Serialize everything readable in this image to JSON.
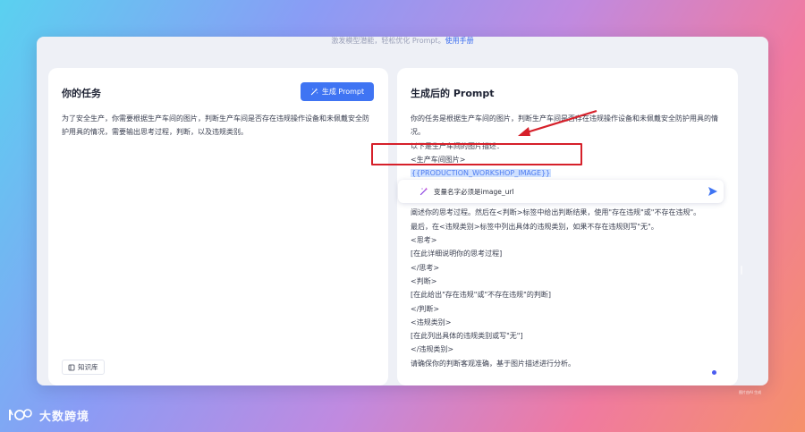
{
  "header": {
    "hint": "激发模型潜能，轻松优化 Prompt。",
    "manual_link": "使用手册"
  },
  "left_panel": {
    "title": "你的任务",
    "generate_button": "生成 Prompt",
    "task_text": "为了安全生产，你需要根据生产车间的图片，判断生产车间是否存在违规操作设备和未佩戴安全防护用具的情况，需要输出思考过程，判断，以及违规类别。",
    "knowledge_base_button": "知识库"
  },
  "right_panel": {
    "title": "生成后的 Prompt",
    "lines_top": [
      "你的任务是根据生产车间的图片，判断生产车间是否存在违规操作设备和未佩戴安全防护用具的情况。",
      "以下是生产车间的图片描述：",
      "<生产车间图片>"
    ],
    "variable": "{{PRODUCTION_WORKSHOP_IMAGE}}",
    "lines_bottom": [
      "阐述你的思考过程。然后在<判断>标签中给出判断结果，使用\"存在违规\"或\"不存在违规\"。",
      "最后，在<违规类别>标签中列出具体的违规类别，如果不存在违规则写\"无\"。",
      "<思考>",
      "[在此详细说明你的思考过程]",
      "</思考>",
      "<判断>",
      "[在此给出\"存在违规\"或\"不存在违规\"的判断]",
      "</判断>",
      "<违规类别>",
      "[在此列出具体的违规类别或写\"无\"]",
      "</违规类别>",
      "请确保你的判断客观准确，基于图片描述进行分析。"
    ]
  },
  "edit_box": {
    "value": "变量名字必须是image_url"
  },
  "footnote": "图片由AI 生成",
  "watermark": "大数跨境",
  "colors": {
    "accent": "#3f74f3",
    "highlight_bg": "#cfe0ff",
    "annotation_red": "#d6202a"
  }
}
